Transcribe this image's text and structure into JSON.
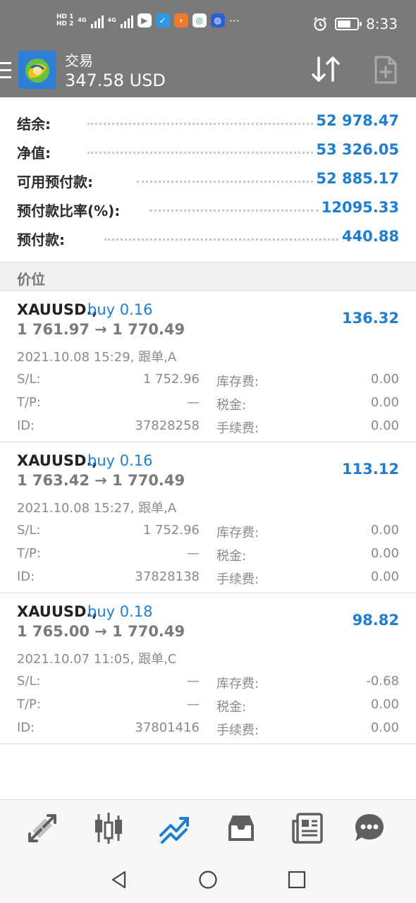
{
  "status_bar": {
    "time": "8:33",
    "sim1": "HD 1",
    "sim2": "HD 2",
    "network1": "4G",
    "network2": "4G",
    "more": "···"
  },
  "app_bar": {
    "title": "交易",
    "subtitle": "347.58 USD"
  },
  "summary": [
    {
      "label": "结余:",
      "value": "52 978.47"
    },
    {
      "label": "净值:",
      "value": "53 326.05"
    },
    {
      "label": "可用预付款:",
      "value": "52 885.17"
    },
    {
      "label": "预付款比率(%):",
      "value": "12095.33"
    },
    {
      "label": "预付款:",
      "value": "440.88"
    }
  ],
  "section_header": "价位",
  "positions": [
    {
      "symbol": "XAUUSD.,",
      "type": "buy 0.16",
      "price": "1 761.97 → 1 770.49",
      "profit": "136.32",
      "time": "2021.10.08 15:29, 跟单,A",
      "sl_label": "S/L:",
      "sl": "1 752.96",
      "tp_label": "T/P:",
      "tp": "—",
      "id_label": "ID:",
      "id": "37828258",
      "swap_label": "库存费:",
      "swap": "0.00",
      "tax_label": "税金:",
      "tax": "0.00",
      "fee_label": "手续费:",
      "fee": "0.00"
    },
    {
      "symbol": "XAUUSD.,",
      "type": "buy 0.16",
      "price": "1 763.42 → 1 770.49",
      "profit": "113.12",
      "time": "2021.10.08 15:27, 跟单,A",
      "sl_label": "S/L:",
      "sl": "1 752.96",
      "tp_label": "T/P:",
      "tp": "—",
      "id_label": "ID:",
      "id": "37828138",
      "swap_label": "库存费:",
      "swap": "0.00",
      "tax_label": "税金:",
      "tax": "0.00",
      "fee_label": "手续费:",
      "fee": "0.00"
    },
    {
      "symbol": "XAUUSD.,",
      "type": "buy 0.18",
      "price": "1 765.00 → 1 770.49",
      "profit": "98.82",
      "time": "2021.10.07 11:05, 跟单,C",
      "sl_label": "S/L:",
      "sl": "—",
      "tp_label": "T/P:",
      "tp": "—",
      "id_label": "ID:",
      "id": "37801416",
      "swap_label": "库存费:",
      "swap": "-0.68",
      "tax_label": "税金:",
      "tax": "0.00",
      "fee_label": "手续费:",
      "fee": "0.00"
    }
  ],
  "bottom_nav": [
    {
      "icon": "quotes-icon",
      "active": false
    },
    {
      "icon": "chart-icon",
      "active": false
    },
    {
      "icon": "trade-icon",
      "active": true
    },
    {
      "icon": "history-icon",
      "active": false
    },
    {
      "icon": "news-icon",
      "active": false
    },
    {
      "icon": "chat-icon",
      "active": false
    }
  ],
  "colors": {
    "accent": "#1e7ed1",
    "header_bg": "#7a7a7a",
    "muted_text": "#8a8a8a"
  }
}
